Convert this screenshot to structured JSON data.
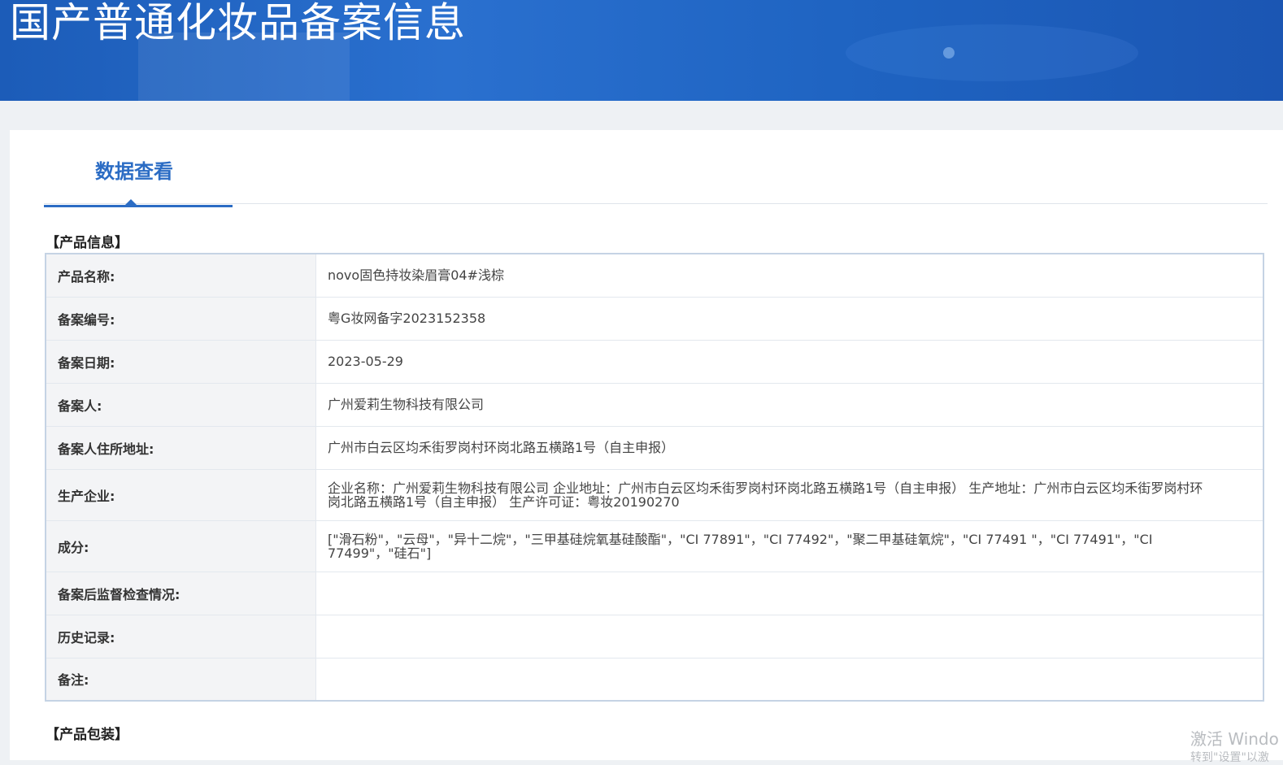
{
  "header": {
    "title": "国产普通化妆品备案信息"
  },
  "tabs": [
    {
      "label": "数据查看",
      "active": true
    }
  ],
  "product_info": {
    "section_title": "【产品信息】",
    "rows": [
      {
        "label": "产品名称:",
        "value": "novo固色持妆染眉膏04#浅棕"
      },
      {
        "label": "备案编号:",
        "value": "粤G妆网备字2023152358"
      },
      {
        "label": "备案日期:",
        "value": "2023-05-29"
      },
      {
        "label": "备案人:",
        "value": "广州爱莉生物科技有限公司"
      },
      {
        "label": "备案人住所地址:",
        "value": "广州市白云区均禾街罗岗村环岗北路五横路1号（自主申报）"
      },
      {
        "label": "生产企业:",
        "value": "企业名称：广州爱莉生物科技有限公司 企业地址：广州市白云区均禾街罗岗村环岗北路五横路1号（自主申报） 生产地址：广州市白云区均禾街罗岗村环岗北路五横路1号（自主申报） 生产许可证：粤妆20190270"
      },
      {
        "label": "成分:",
        "value": "[\"滑石粉\"，\"云母\"，\"异十二烷\"，\"三甲基硅烷氧基硅酸酯\"，\"CI 77891\"，\"CI 77492\"，\"聚二甲基硅氧烷\"，\"CI 77491 \"，\"CI 77491\"，\"CI 77499\"，\"硅石\"]"
      },
      {
        "label": "备案后监督检查情况:",
        "value": ""
      },
      {
        "label": "历史记录:",
        "value": ""
      },
      {
        "label": "备注:",
        "value": ""
      }
    ]
  },
  "packaging": {
    "section_title": "【产品包装】"
  },
  "watermark": {
    "line1": "激活 Windo",
    "line2": "转到\"设置\"以激"
  },
  "colors": {
    "banner": "#1f64c2",
    "accent": "#2b6cc4",
    "label_bg": "#f3f4f6",
    "border": "#c5d3e4"
  }
}
